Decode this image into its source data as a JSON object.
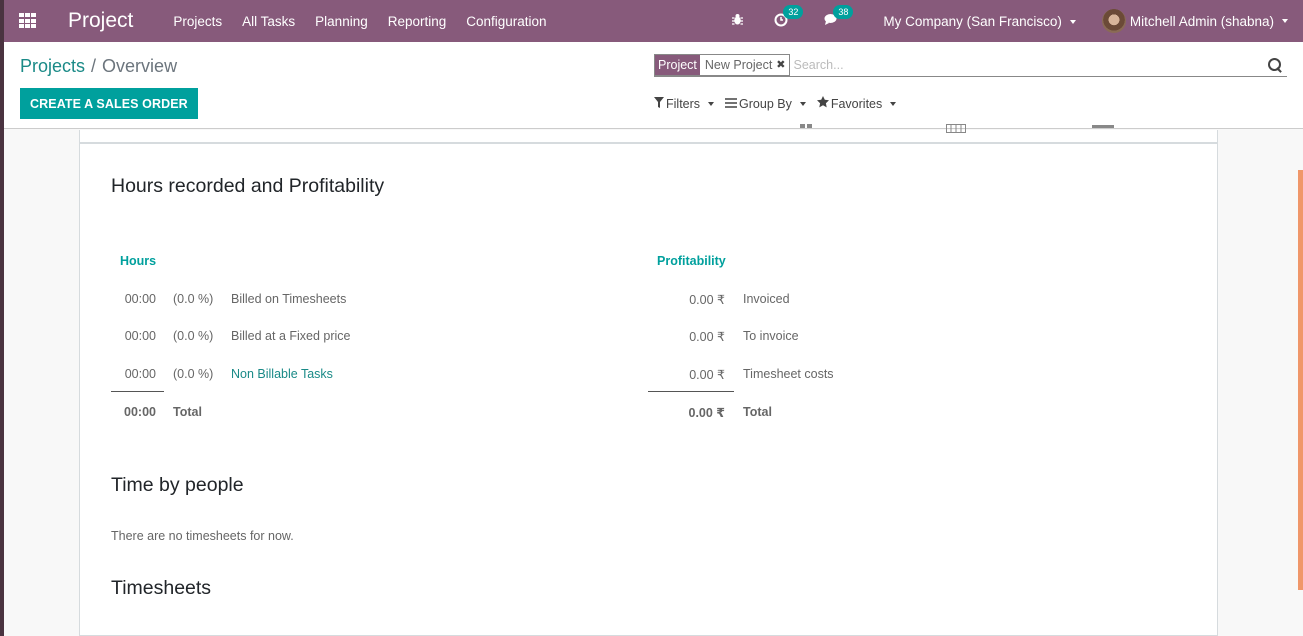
{
  "navbar": {
    "app_title": "Project",
    "menu": [
      "Projects",
      "All Tasks",
      "Planning",
      "Reporting",
      "Configuration"
    ],
    "activity_count": "32",
    "messages_count": "38",
    "company": "My Company (San Francisco)",
    "user": "Mitchell Admin (shabna)",
    "colors": {
      "brand": "#875a7b",
      "accent": "#00a09d"
    }
  },
  "control_panel": {
    "breadcrumb": {
      "parent": "Projects",
      "separator": "/",
      "current": "Overview"
    },
    "primary_button": "CREATE A SALES ORDER",
    "search": {
      "facet_label": "Project",
      "facet_value": "New Project",
      "placeholder": "Search..."
    },
    "filters": {
      "filters": "Filters",
      "group_by": "Group By",
      "favorites": "Favorites"
    }
  },
  "overview": {
    "section1_title": "Hours recorded and Profitability",
    "hours": {
      "title": "Hours",
      "rows": [
        {
          "value": "00:00",
          "pct": "(0.0 %)",
          "label": "Billed on Timesheets",
          "link": false
        },
        {
          "value": "00:00",
          "pct": "(0.0 %)",
          "label": "Billed at a Fixed price",
          "link": false
        },
        {
          "value": "00:00",
          "pct": "(0.0 %)",
          "label": "Non Billable Tasks",
          "link": true
        }
      ],
      "total_value": "00:00",
      "total_label": "Total"
    },
    "profitability": {
      "title": "Profitability",
      "rows": [
        {
          "value": "0.00 ₹",
          "label": "Invoiced"
        },
        {
          "value": "0.00 ₹",
          "label": "To invoice"
        },
        {
          "value": "0.00 ₹",
          "label": "Timesheet costs"
        }
      ],
      "total_value": "0.00 ₹",
      "total_label": "Total"
    },
    "section2_title": "Time by people",
    "section2_empty": "There are no timesheets for now.",
    "section3_title": "Timesheets"
  }
}
